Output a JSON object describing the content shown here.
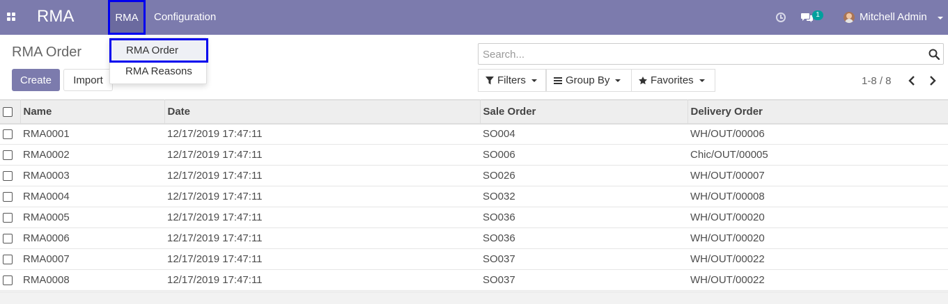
{
  "navbar": {
    "brand": "RMA",
    "menu_rma": "RMA",
    "menu_configuration": "Configuration",
    "chat_badge": "1",
    "user_name": "Mitchell Admin"
  },
  "dropdown": {
    "items": [
      {
        "label": "RMA Order"
      },
      {
        "label": "RMA Reasons"
      }
    ]
  },
  "control": {
    "title": "RMA Order",
    "create_label": "Create",
    "import_label": "Import",
    "search_placeholder": "Search...",
    "filters_label": "Filters",
    "groupby_label": "Group By",
    "favorites_label": "Favorites",
    "pager": "1-8 / 8"
  },
  "table": {
    "columns": [
      "Name",
      "Date",
      "Sale Order",
      "Delivery Order"
    ],
    "rows": [
      [
        "RMA0001",
        "12/17/2019 17:47:11",
        "SO004",
        "WH/OUT/00006"
      ],
      [
        "RMA0002",
        "12/17/2019 17:47:11",
        "SO006",
        "Chic/OUT/00005"
      ],
      [
        "RMA0003",
        "12/17/2019 17:47:11",
        "SO026",
        "WH/OUT/00007"
      ],
      [
        "RMA0004",
        "12/17/2019 17:47:11",
        "SO032",
        "WH/OUT/00008"
      ],
      [
        "RMA0005",
        "12/17/2019 17:47:11",
        "SO036",
        "WH/OUT/00020"
      ],
      [
        "RMA0006",
        "12/17/2019 17:47:11",
        "SO036",
        "WH/OUT/00020"
      ],
      [
        "RMA0007",
        "12/17/2019 17:47:11",
        "SO037",
        "WH/OUT/00022"
      ],
      [
        "RMA0008",
        "12/17/2019 17:47:11",
        "SO037",
        "WH/OUT/00022"
      ]
    ]
  },
  "colors": {
    "brand": "#7c7bad",
    "highlight": "#0000ee",
    "badge": "#00a09d"
  },
  "icons": [
    "apps-icon",
    "clock-icon",
    "chat-icon",
    "avatar",
    "search-icon",
    "filter-icon",
    "list-icon",
    "star-icon",
    "chevron-left-icon",
    "chevron-right-icon"
  ]
}
